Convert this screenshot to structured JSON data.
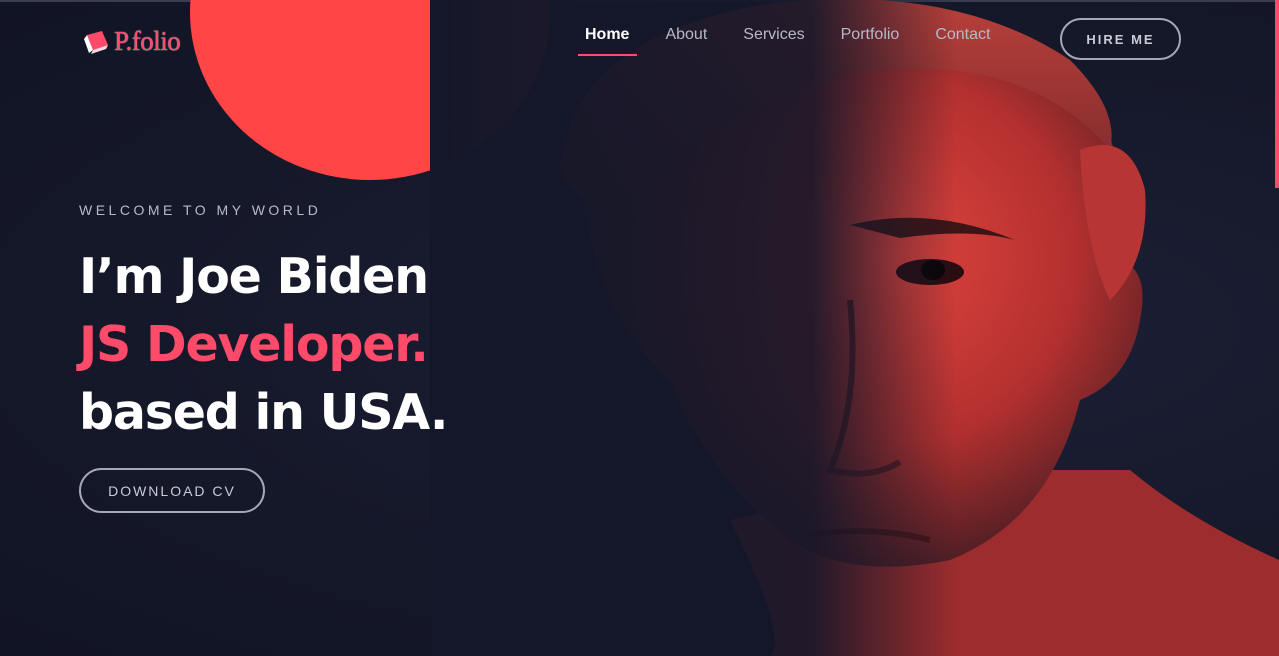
{
  "brand": {
    "logo_text": "P.folio",
    "accent": "#ff4a6a",
    "background": "#171a2e"
  },
  "nav": {
    "items": [
      {
        "label": "Home",
        "active": true
      },
      {
        "label": "About",
        "active": false
      },
      {
        "label": "Services",
        "active": false
      },
      {
        "label": "Portfolio",
        "active": false
      },
      {
        "label": "Contact",
        "active": false
      }
    ],
    "cta_label": "HIRE ME"
  },
  "hero": {
    "eyebrow": "WELCOME TO MY WORLD",
    "line1": "I’m Joe Biden",
    "line2": "JS Developer.",
    "line3": "based in USA.",
    "button_label": "DOWNLOAD CV",
    "highlight_color": "#ff4545"
  }
}
